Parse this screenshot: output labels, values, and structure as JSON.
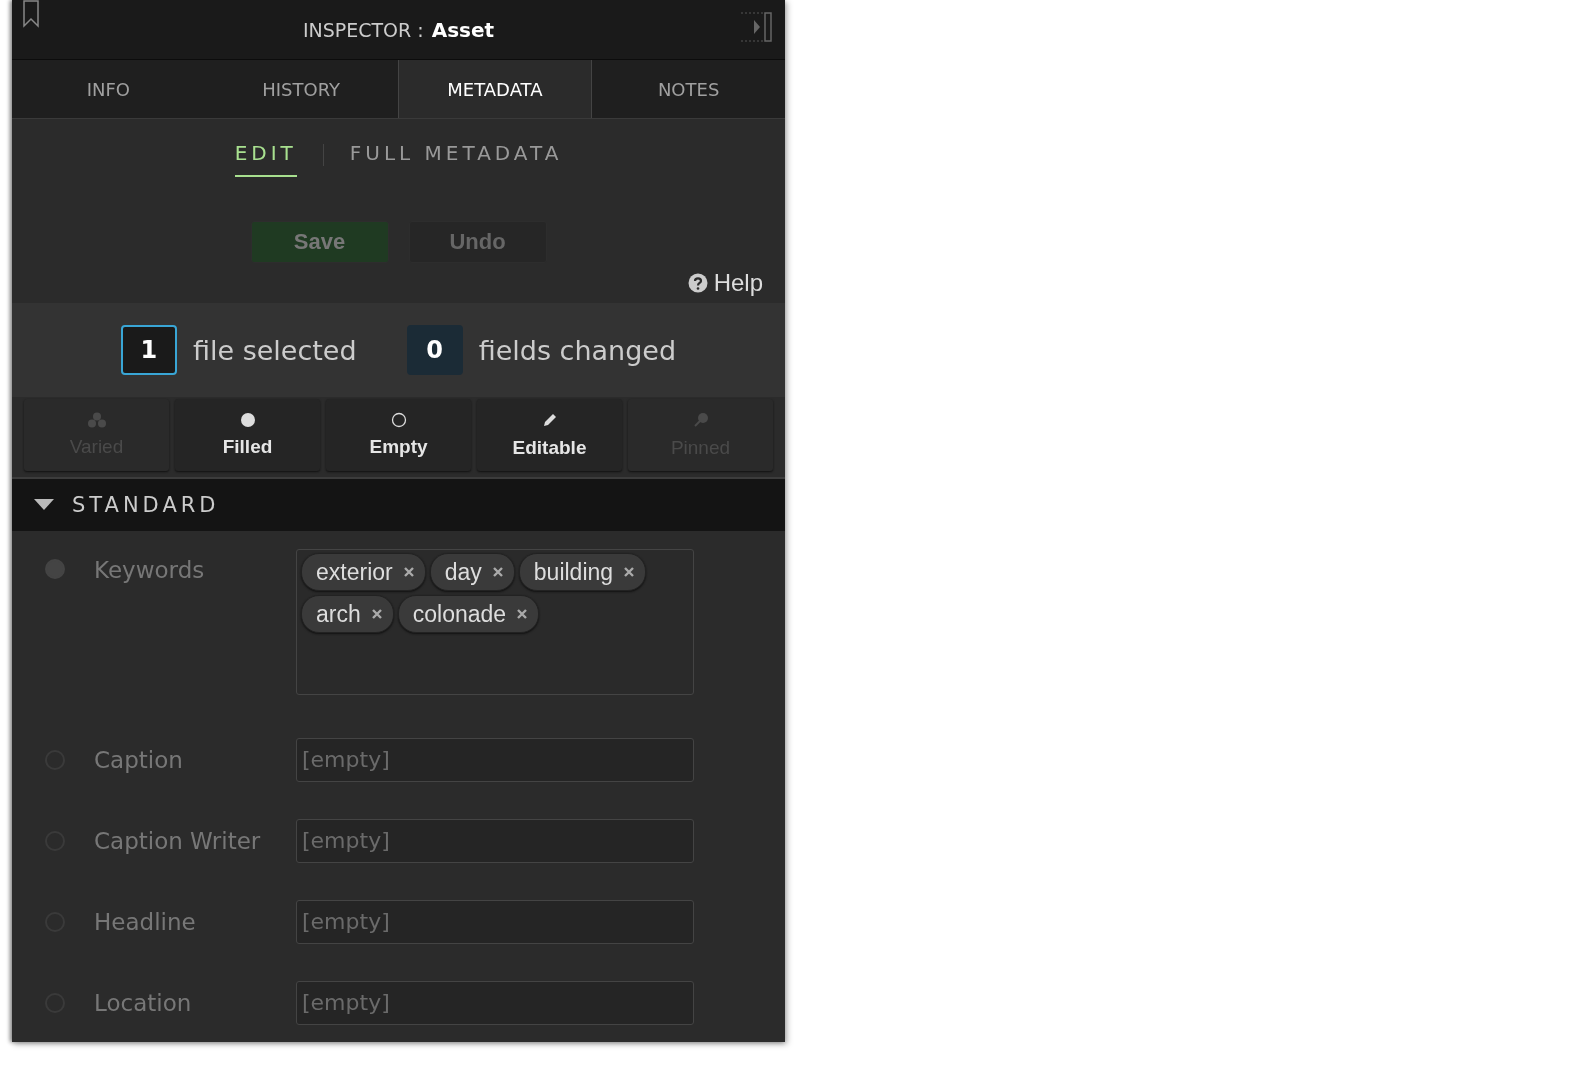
{
  "header": {
    "label": "INSPECTOR :",
    "title": "Asset"
  },
  "tabs": [
    {
      "label": "INFO",
      "selected": false
    },
    {
      "label": "HISTORY",
      "selected": false
    },
    {
      "label": "METADATA",
      "selected": true
    },
    {
      "label": "NOTES",
      "selected": false
    }
  ],
  "subtabs": [
    {
      "label": "EDIT",
      "selected": true
    },
    {
      "label": "FULL METADATA",
      "selected": false
    }
  ],
  "actions": [
    {
      "label": "Save",
      "kind": "save"
    },
    {
      "label": "Undo",
      "kind": "undo"
    }
  ],
  "help": "Help",
  "counts": [
    {
      "value": "1",
      "label": "file selected",
      "highlighted": true
    },
    {
      "value": "0",
      "label": "fields changed",
      "highlighted": false
    }
  ],
  "filters": [
    {
      "label": "Varied",
      "kind": "varied",
      "disabled": true
    },
    {
      "label": "Filled",
      "kind": "filled",
      "disabled": false
    },
    {
      "label": "Empty",
      "kind": "empty",
      "disabled": false
    },
    {
      "label": "Editable",
      "kind": "editable",
      "disabled": false
    },
    {
      "label": "Pinned",
      "kind": "pinned",
      "disabled": true
    }
  ],
  "section": {
    "title": "STANDARD",
    "expanded": true
  },
  "fields": [
    {
      "label": "Keywords",
      "kind": "tags",
      "filled": true,
      "tags": [
        "exterior",
        "day",
        "building",
        "arch",
        "colonade"
      ]
    },
    {
      "label": "Caption",
      "kind": "text",
      "filled": false,
      "placeholder": "[empty]"
    },
    {
      "label": "Caption Writer",
      "kind": "text",
      "filled": false,
      "placeholder": "[empty]"
    },
    {
      "label": "Headline",
      "kind": "text",
      "filled": false,
      "placeholder": "[empty]"
    },
    {
      "label": "Location",
      "kind": "text",
      "filled": false,
      "placeholder": "[empty]"
    }
  ]
}
